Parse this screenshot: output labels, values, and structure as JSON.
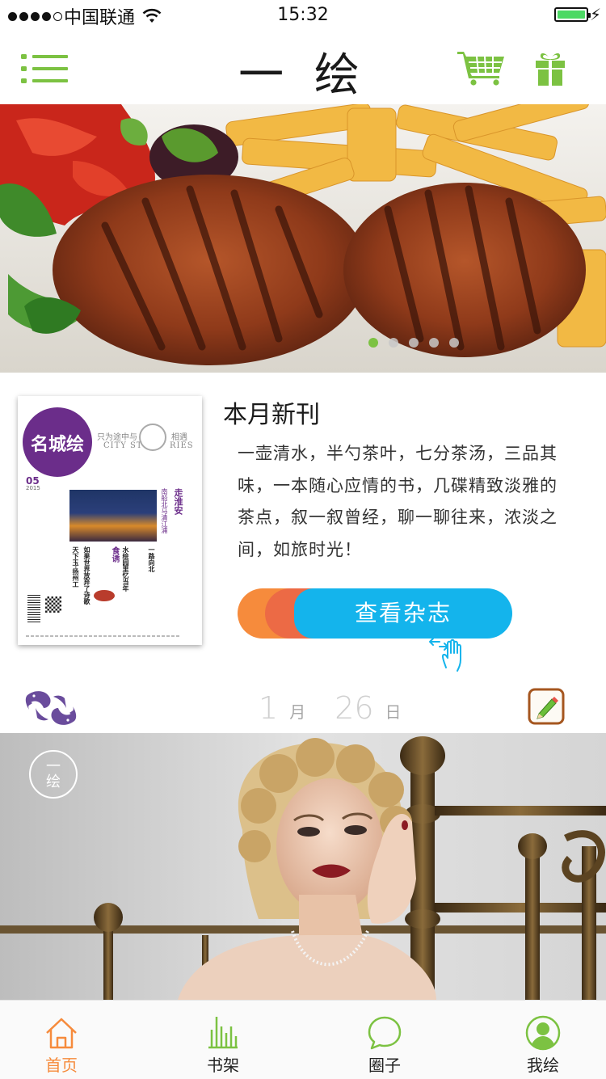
{
  "status_bar": {
    "carrier": "中国联通",
    "time": "15:32",
    "signal_bars": 4,
    "battery_level": 1.0
  },
  "nav": {
    "brand": "一 绘",
    "icons": [
      "menu-icon",
      "cart-icon",
      "gift-icon"
    ],
    "accent_color": "#7cc242"
  },
  "banner": {
    "slide_count": 5,
    "active_slide": 1
  },
  "magazine": {
    "section_title": "本月新刊",
    "description": "一壶清水，半勺茶叶，七分茶汤，三品其味，一本随心应情的书，几碟精致淡雅的茶点，叙一叙曾经，聊一聊往来，浓淡之间，如旅时光！",
    "button_label": "查看杂志",
    "cover": {
      "logo": "名城绘",
      "tagline": "只为途中与",
      "tagline2": "相遇",
      "city": "CITY ST",
      "ries": "RIES",
      "issue": "05",
      "year": "2015",
      "headline_side": "走淮安",
      "sub_side": "南船北马清江浦",
      "col1": "一路向北",
      "col2": "水绘园里忆当年",
      "col3": "食诱",
      "col4": "如果世界放弃了诗歌",
      "col5": "天下玉·扬州工"
    }
  },
  "date_row": {
    "month": "1",
    "month_unit": "月",
    "day": "26",
    "day_unit": "日"
  },
  "photo": {
    "badge_line1": "一",
    "badge_line2": "绘"
  },
  "tabbar": {
    "tabs": [
      {
        "label": "首页",
        "icon": "home-icon",
        "active": true
      },
      {
        "label": "书架",
        "icon": "bookshelf-icon",
        "active": false
      },
      {
        "label": "圈子",
        "icon": "chat-bubble-icon",
        "active": false
      },
      {
        "label": "我绘",
        "icon": "profile-icon",
        "active": false
      }
    ],
    "active_color": "#f68b3c",
    "icon_color": "#7cc242"
  }
}
